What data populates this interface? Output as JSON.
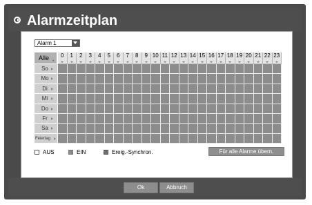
{
  "dialog": {
    "title": "Alarmzeitplan"
  },
  "alarm_select": {
    "value": "Alarm 1"
  },
  "schedule": {
    "all_label": "Alle",
    "hours": [
      "0",
      "1",
      "2",
      "3",
      "4",
      "5",
      "6",
      "7",
      "8",
      "9",
      "10",
      "11",
      "12",
      "13",
      "14",
      "15",
      "16",
      "17",
      "18",
      "19",
      "20",
      "21",
      "22",
      "23"
    ],
    "days": [
      "So",
      "Mo",
      "Di",
      "Mi",
      "Do",
      "Fr",
      "Sa",
      "Feiertag"
    ]
  },
  "legend": {
    "off_label": "AUS",
    "on_label": "EIN",
    "event_sync_label": "Ereig.-Synchron.",
    "off_color": "#ffffff",
    "on_color": "#8c8c8c",
    "event_sync_color": "#6f6f6f"
  },
  "buttons": {
    "apply_all_label": "Für alle Alarme übern.",
    "ok_label": "Ok",
    "cancel_label": "Abbruch"
  },
  "colors": {
    "frame": "#4a4a4a",
    "cell_off": "#8c8c8c",
    "header_bg": "#e4e4e4",
    "button_bg": "#8e8e8e"
  }
}
